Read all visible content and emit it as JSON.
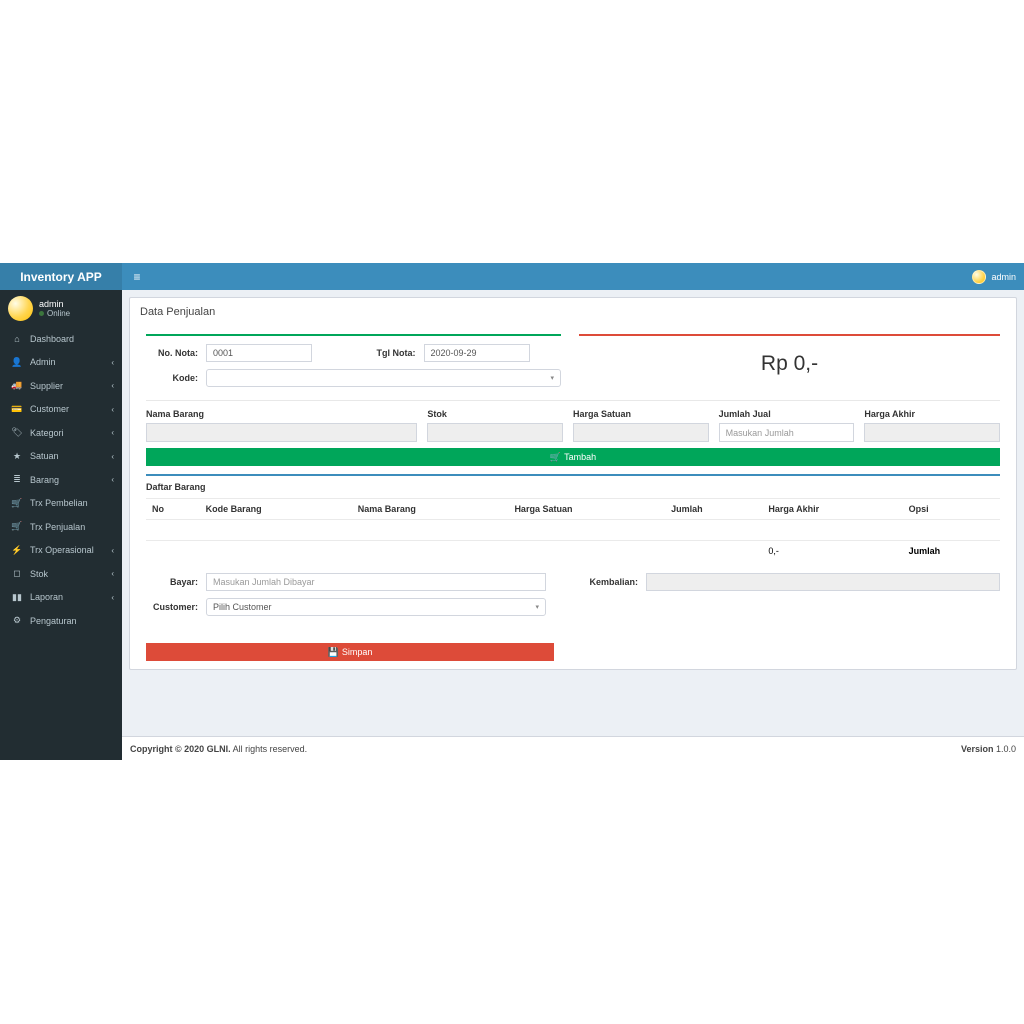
{
  "app_name": "Inventory APP",
  "top_user": "admin",
  "side_user": {
    "name": "admin",
    "status": "Online"
  },
  "menu": [
    {
      "icon": "⌂",
      "label": "Dashboard",
      "expandable": false
    },
    {
      "icon": "👤",
      "label": "Admin",
      "expandable": true
    },
    {
      "icon": "🚚",
      "label": "Supplier",
      "expandable": true
    },
    {
      "icon": "💳",
      "label": "Customer",
      "expandable": true
    },
    {
      "icon": "🏷",
      "label": "Kategori",
      "expandable": true
    },
    {
      "icon": "★",
      "label": "Satuan",
      "expandable": true
    },
    {
      "icon": "≣",
      "label": "Barang",
      "expandable": true
    },
    {
      "icon": "🛒",
      "label": "Trx Pembelian",
      "expandable": false
    },
    {
      "icon": "🛒",
      "label": "Trx Penjualan",
      "expandable": false
    },
    {
      "icon": "⚡",
      "label": "Trx Operasional",
      "expandable": true
    },
    {
      "icon": "◻",
      "label": "Stok",
      "expandable": true
    },
    {
      "icon": "▮▮",
      "label": "Laporan",
      "expandable": true
    },
    {
      "icon": "⚙",
      "label": "Pengaturan",
      "expandable": false
    }
  ],
  "page_title": "Data Penjualan",
  "form": {
    "no_nota_label": "No. Nota:",
    "no_nota_value": "0001",
    "tgl_nota_label": "Tgl Nota:",
    "tgl_nota_value": "2020-09-29",
    "kode_label": "Kode:",
    "amount_display": "Rp 0,-"
  },
  "item_fields": {
    "nama_barang": "Nama Barang",
    "stok": "Stok",
    "harga_satuan": "Harga Satuan",
    "jumlah_jual": "Jumlah Jual",
    "jumlah_jual_ph": "Masukan Jumlah",
    "harga_akhir": "Harga Akhir"
  },
  "tambah_label": "Tambah",
  "list_title": "Daftar Barang",
  "table_headers": [
    "No",
    "Kode Barang",
    "Nama Barang",
    "Harga Satuan",
    "Jumlah",
    "Harga Akhir",
    "Opsi"
  ],
  "totals_row": {
    "harga_akhir": "0,-",
    "label": "Jumlah"
  },
  "payment": {
    "bayar_label": "Bayar:",
    "bayar_ph": "Masukan Jumlah Dibayar",
    "customer_label": "Customer:",
    "customer_ph": "Pilih Customer",
    "kembalian_label": "Kembalian:"
  },
  "simpan_label": "Simpan",
  "footer": {
    "copyright_pre": "Copyright © 2020 ",
    "company": "GLNI.",
    "copyright_post": " All rights reserved.",
    "version_label": "Version",
    "version": " 1.0.0"
  }
}
